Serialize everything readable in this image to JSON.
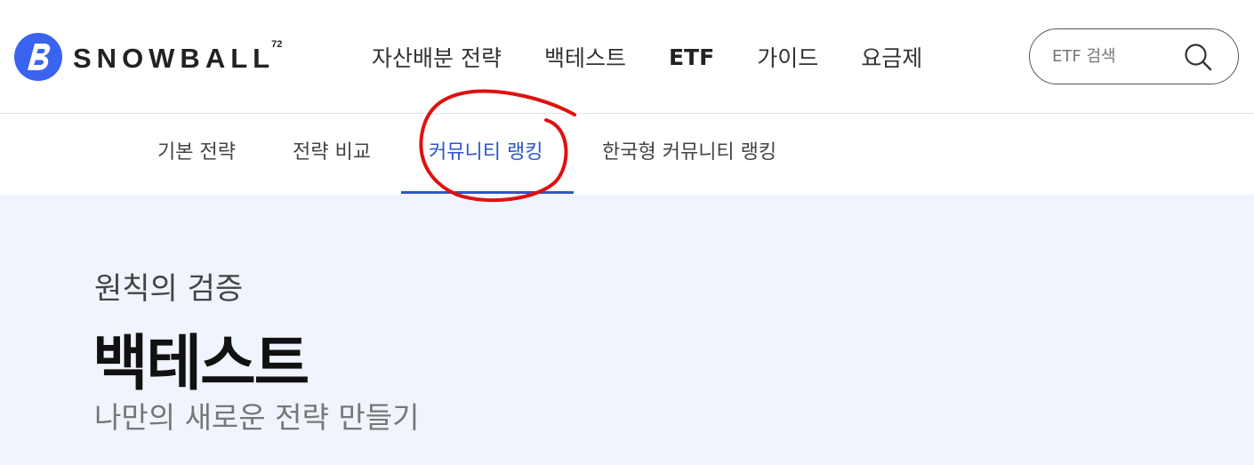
{
  "brand": {
    "name": "SNOWBALL",
    "sup": "72",
    "colors": {
      "accent": "#3154c8",
      "logo_blue": "#3a63f0",
      "hero_bg": "#f0f4fd",
      "annotation_red": "#e01010"
    }
  },
  "gnb": {
    "items": [
      {
        "label": "자산배분 전략"
      },
      {
        "label": "백테스트"
      },
      {
        "label": "ETF"
      },
      {
        "label": "가이드"
      },
      {
        "label": "요금제"
      }
    ]
  },
  "search": {
    "placeholder": "ETF 검색",
    "icon": "search-icon"
  },
  "subnav": {
    "items": [
      {
        "label": "기본 전략"
      },
      {
        "label": "전략 비교"
      },
      {
        "label": "커뮤니티 랭킹",
        "active": true
      },
      {
        "label": "한국형 커뮤니티 랭킹"
      }
    ]
  },
  "hero": {
    "eyebrow": "원칙의 검증",
    "title": "백테스트",
    "subtitle": "나만의 새로운 전략 만들기"
  }
}
